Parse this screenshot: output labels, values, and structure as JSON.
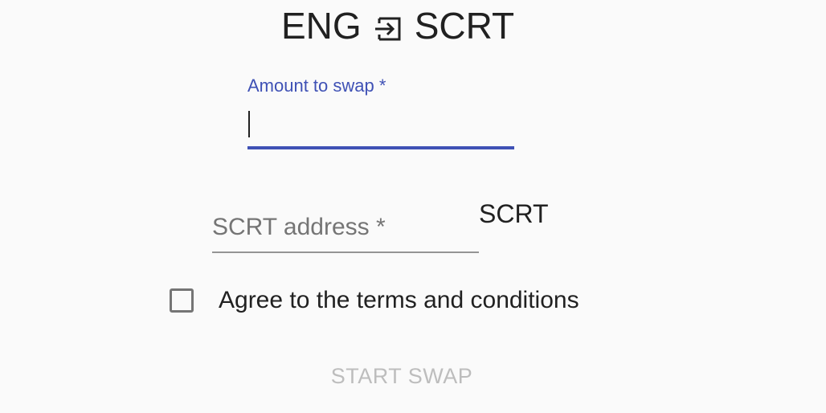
{
  "header": {
    "from_token": "ENG",
    "to_token": "SCRT",
    "swap_icon": "swap-arrow-icon"
  },
  "form": {
    "amount": {
      "label": "Amount to swap *",
      "value": ""
    },
    "address": {
      "label": "SCRT address *",
      "value": "",
      "suffix": "SCRT"
    },
    "agree": {
      "label": "Agree to the terms and conditions",
      "checked": false
    },
    "submit": {
      "label": "START SWAP",
      "disabled": true
    }
  },
  "colors": {
    "accent": "#3f51b5",
    "text": "#212121",
    "muted": "#757575",
    "disabled": "#bdbdbd",
    "background": "#fafafa"
  }
}
